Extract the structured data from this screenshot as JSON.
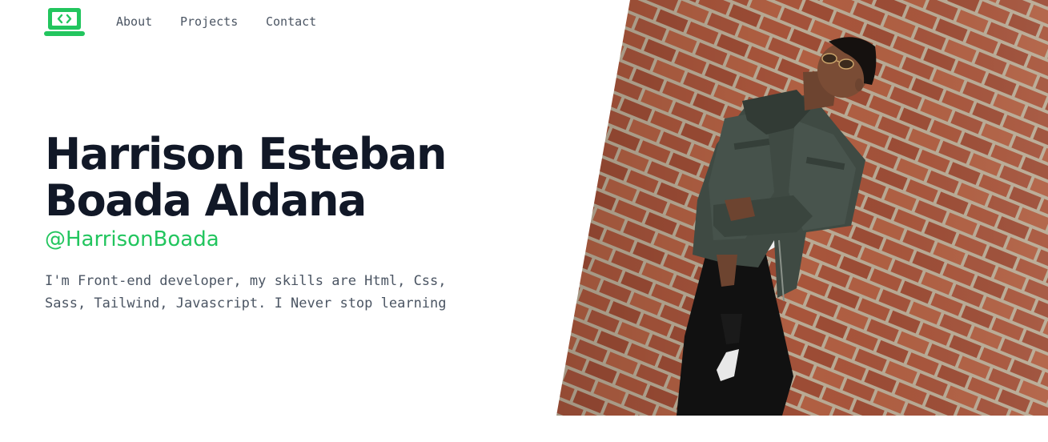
{
  "nav": {
    "about": "About",
    "projects": "Projects",
    "contact": "Contact"
  },
  "hero": {
    "name_line1": "Harrison Esteban",
    "name_line2": "Boada Aldana",
    "handle": "@HarrisonBoada",
    "bio_line1": "I'm Front-end developer, my skills are Html, Css,",
    "bio_line2": "Sass, Tailwind, Javascript. I Never stop learning"
  },
  "logo": {
    "icon": "laptop-code-icon",
    "color": "#22c55e"
  },
  "photo": {
    "icon": "portrait-photo"
  },
  "colors": {
    "accent": "#22c55e",
    "heading": "#111827",
    "text": "#4b5563",
    "brick": "#a5553a",
    "mortar": "#b9aa94"
  }
}
